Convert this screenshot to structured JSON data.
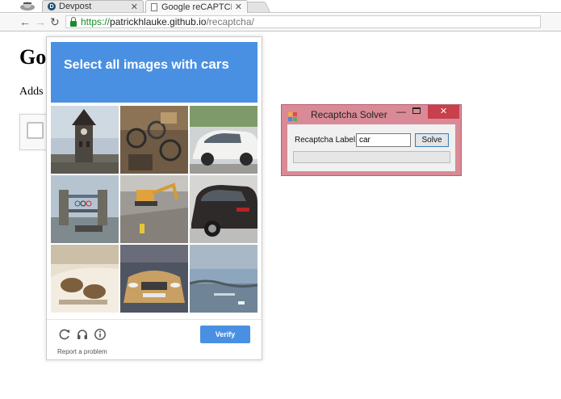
{
  "browser": {
    "tabs": [
      {
        "title": "Devpost",
        "active": false
      },
      {
        "title": "Google reCAPTCHA",
        "active": true
      }
    ],
    "url": {
      "scheme": "https://",
      "host": "patrickhlauke.github.io",
      "path": "/recaptcha/"
    },
    "icons": [
      "back-icon",
      "forward-icon",
      "reload-icon",
      "lock-icon"
    ]
  },
  "page": {
    "heading": "Go",
    "text": "Adds t"
  },
  "challenge": {
    "prompt_prefix": "Select all images with",
    "prompt_keyword": "cars",
    "tiles": [
      "clock-tower",
      "bicycles-shop",
      "white-car",
      "tower-bridge",
      "excavator-demolition",
      "black-suv",
      "car-interior",
      "car-front-showroom",
      "lake-sunset"
    ],
    "controls": [
      "reload-icon",
      "audio-icon",
      "info-icon"
    ],
    "verify_label": "Verify",
    "report_label": "Report a problem",
    "accent_color": "#4a90e2"
  },
  "solver": {
    "title": "Recaptcha Solver",
    "label": "Recaptcha Label:",
    "input_value": "car",
    "button_label": "Solve",
    "progress": 0,
    "close_glyph": "✕",
    "min_glyph": "—"
  }
}
